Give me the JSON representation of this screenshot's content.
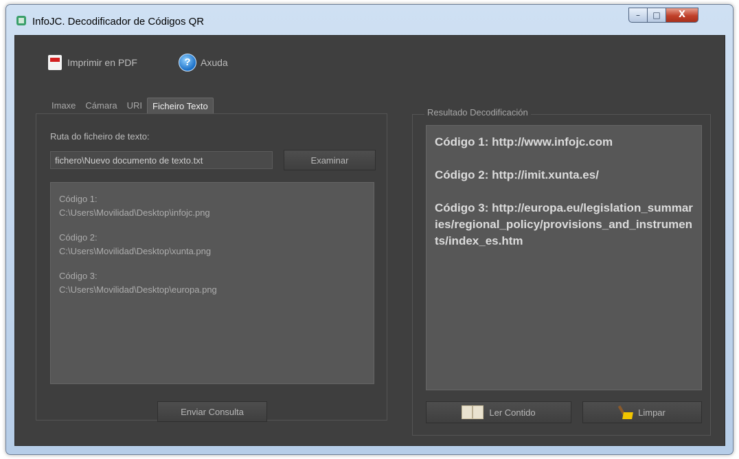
{
  "window": {
    "title": "InfoJC. Decodificador de Códigos QR",
    "minimize_glyph": "–",
    "maximize_glyph": "□",
    "close_glyph": "X"
  },
  "toolbar": {
    "print_label": "Imprimir en PDF",
    "help_label": "Axuda",
    "help_glyph": "?"
  },
  "tabs": [
    {
      "label": "Imaxe",
      "active": false
    },
    {
      "label": "Cámara",
      "active": false
    },
    {
      "label": "URI",
      "active": false
    },
    {
      "label": "Ficheiro Texto",
      "active": true
    }
  ],
  "left_panel": {
    "path_label": "Ruta do ficheiro de texto:",
    "path_value": "fichero\\Nuevo documento de texto.txt",
    "browse_label": "Examinar",
    "codes": [
      {
        "title": "Código 1:",
        "path": "C:\\Users\\Movilidad\\Desktop\\infojc.png"
      },
      {
        "title": "Código 2:",
        "path": "C:\\Users\\Movilidad\\Desktop\\xunta.png"
      },
      {
        "title": "Código 3:",
        "path": "C:\\Users\\Movilidad\\Desktop\\europa.png"
      }
    ],
    "submit_label": "Enviar Consulta"
  },
  "right_panel": {
    "legend": "Resultado Decodificación",
    "results": [
      "Código 1: http://www.infojc.com",
      "Código 2: http://imit.xunta.es/",
      "Código 3: http://europa.eu/legislation_summaries/regional_policy/provisions_and_instruments/index_es.htm"
    ],
    "read_label": "Ler Contido",
    "clear_label": "Limpar"
  }
}
